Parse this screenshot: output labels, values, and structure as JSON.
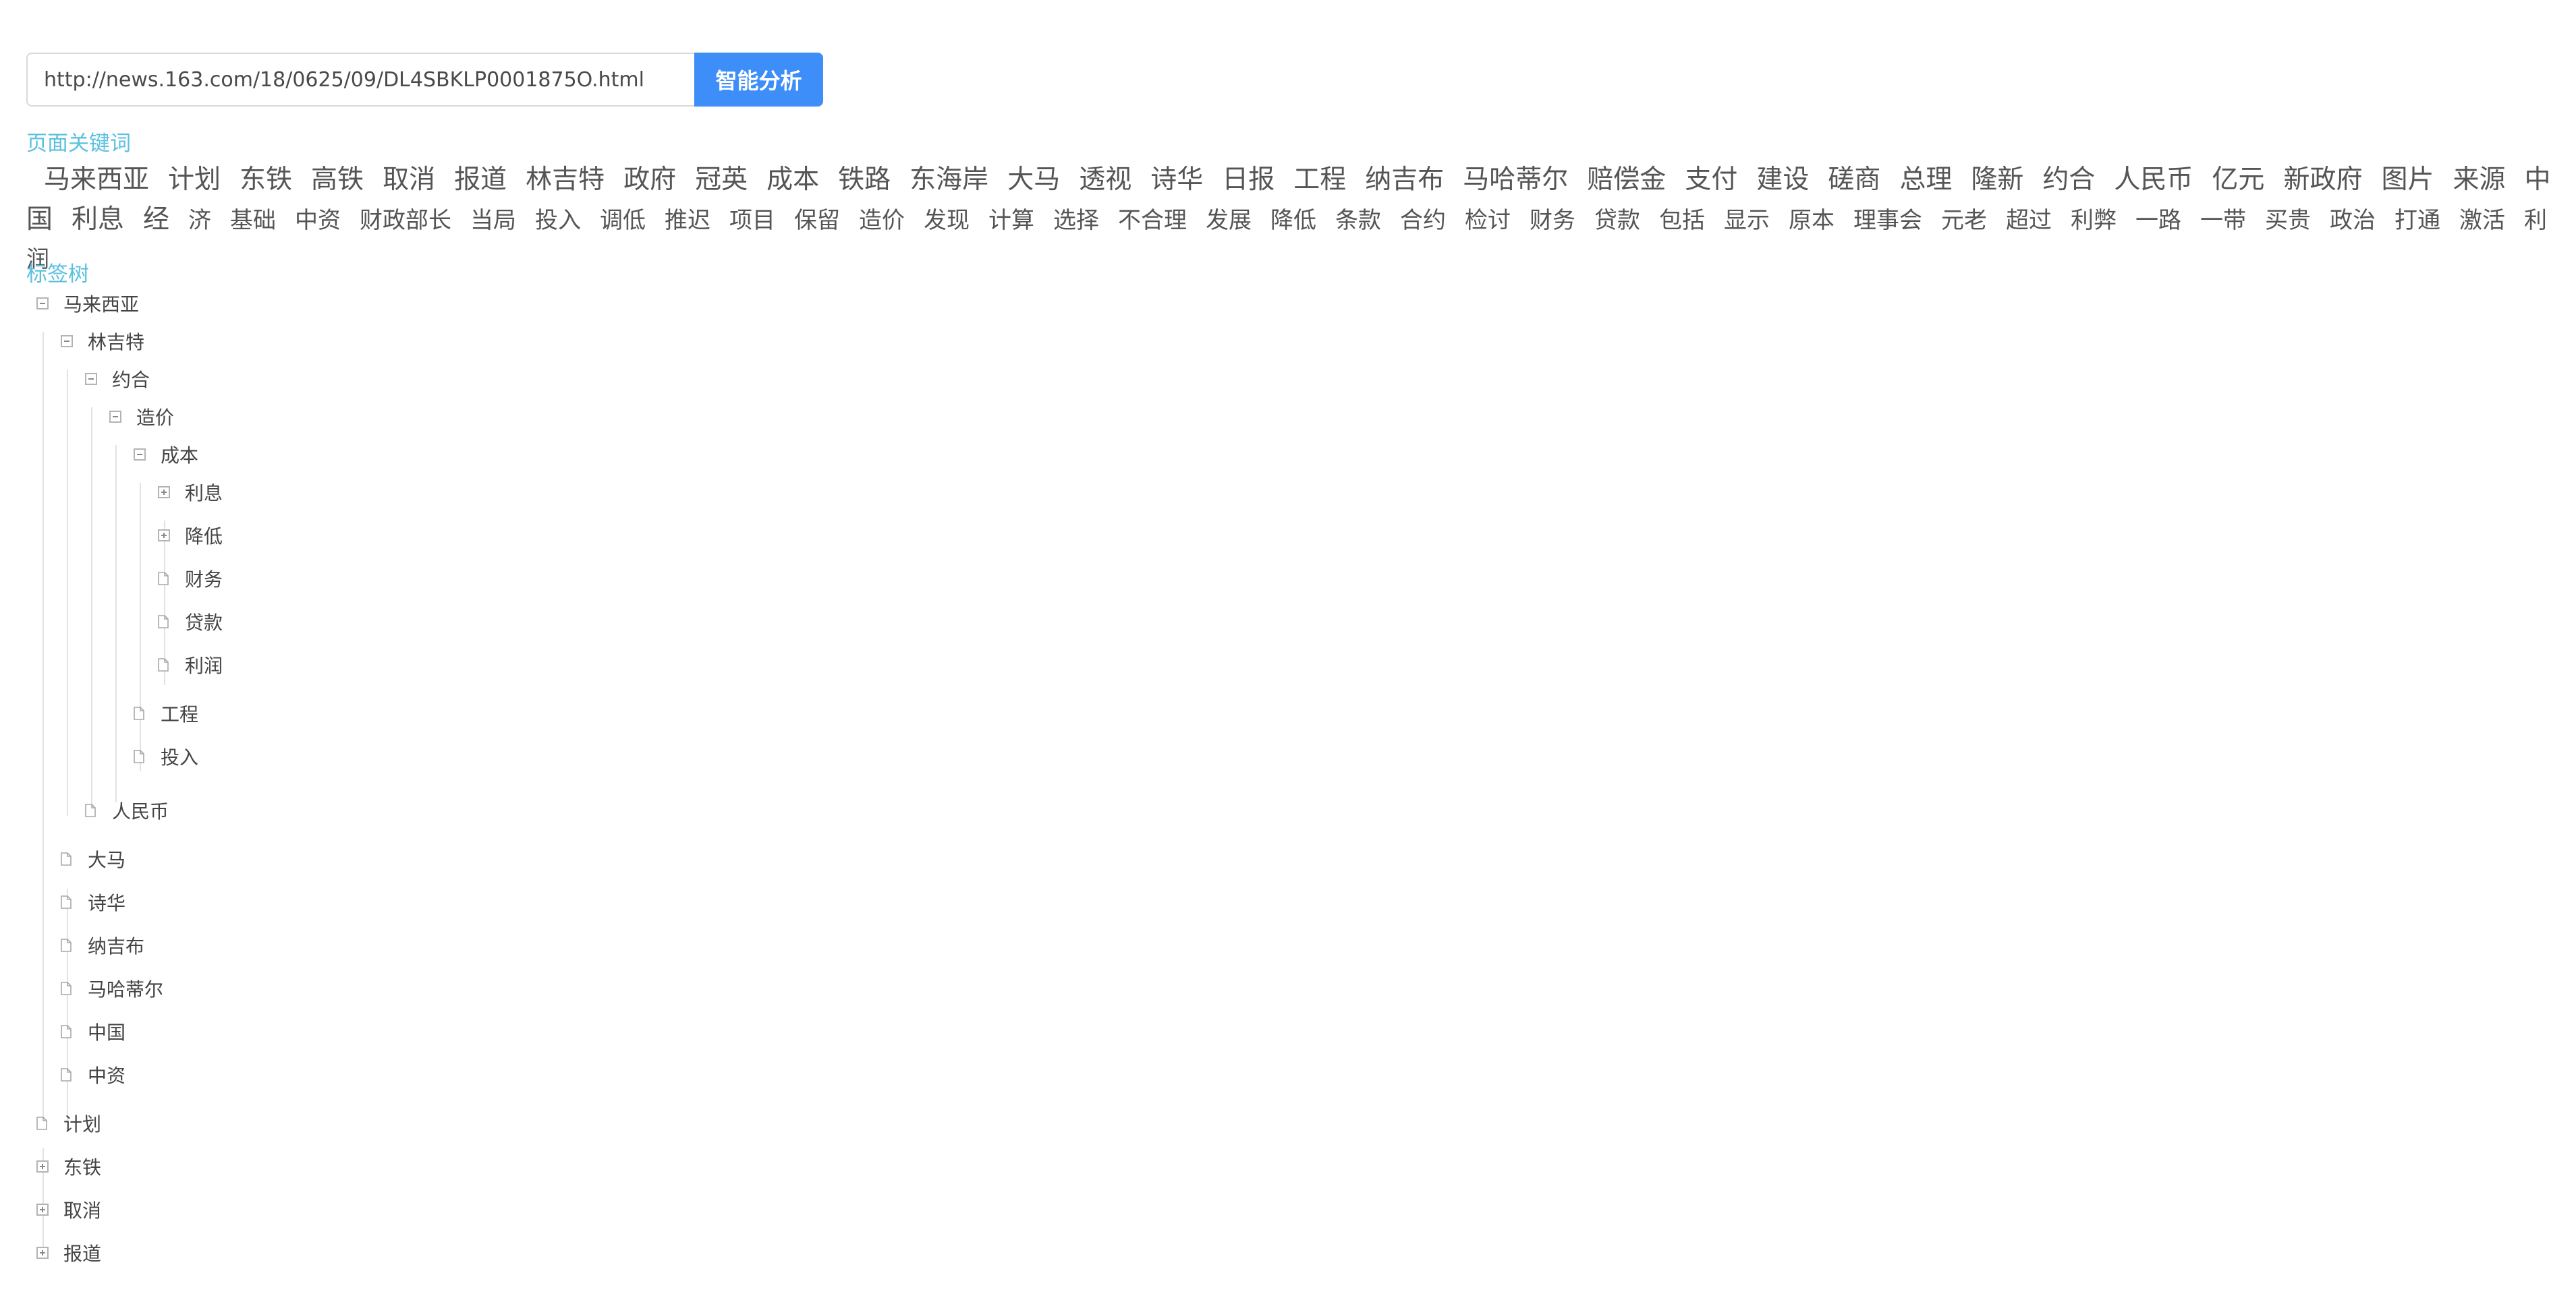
{
  "search": {
    "url_value": "http://news.163.com/18/0625/09/DL4SBKLP0001875O.html",
    "button_label": "智能分析"
  },
  "keywords_section": {
    "title": "页面关键词",
    "items": [
      "马来西亚",
      "计划",
      "东铁",
      "高铁",
      "取消",
      "报道",
      "林吉特",
      "政府",
      "冠英",
      "成本",
      "铁路",
      "东海岸",
      "大马",
      "透视",
      "诗华",
      "日报",
      "工程",
      "纳吉布",
      "马哈蒂尔",
      "赔偿金",
      "支付",
      "建设",
      "磋商",
      "总理",
      "隆新",
      "约合",
      "人民币",
      "亿元",
      "新政府",
      "图片",
      "来源",
      "中国",
      "利息",
      "经",
      "济",
      "基础",
      "中资",
      "财政部长",
      "当局",
      "投入",
      "调低",
      "推迟",
      "项目",
      "保留",
      "造价",
      "发现",
      "计算",
      "选择",
      "不合理",
      "发展",
      "降低",
      "条款",
      "合约",
      "检讨",
      "财务",
      "贷款",
      "包括",
      "显示",
      "原本",
      "理事会",
      "元老",
      "超过",
      "利弊",
      "一路",
      "一带",
      "买贵",
      "政治",
      "打通",
      "激活",
      "利润"
    ]
  },
  "tree_section": {
    "title": "标签树",
    "nodes": [
      {
        "label": "马来西亚",
        "state": "expanded"
      },
      {
        "label": "林吉特",
        "state": "expanded"
      },
      {
        "label": "约合",
        "state": "expanded"
      },
      {
        "label": "造价",
        "state": "expanded"
      },
      {
        "label": "成本",
        "state": "expanded"
      },
      {
        "label": "利息",
        "state": "collapsed"
      },
      {
        "label": "降低",
        "state": "collapsed"
      },
      {
        "label": "财务",
        "state": "leaf"
      },
      {
        "label": "贷款",
        "state": "leaf"
      },
      {
        "label": "利润",
        "state": "leaf"
      },
      {
        "label": "工程",
        "state": "leaf"
      },
      {
        "label": "投入",
        "state": "leaf"
      },
      {
        "label": "人民币",
        "state": "leaf"
      },
      {
        "label": "大马",
        "state": "leaf"
      },
      {
        "label": "诗华",
        "state": "leaf"
      },
      {
        "label": "纳吉布",
        "state": "leaf"
      },
      {
        "label": "马哈蒂尔",
        "state": "leaf"
      },
      {
        "label": "中国",
        "state": "leaf"
      },
      {
        "label": "中资",
        "state": "leaf"
      },
      {
        "label": "计划",
        "state": "leaf"
      },
      {
        "label": "东铁",
        "state": "collapsed"
      },
      {
        "label": "取消",
        "state": "collapsed"
      },
      {
        "label": "报道",
        "state": "collapsed"
      }
    ]
  },
  "colors": {
    "accent_button": "#3d8ef8",
    "section_title": "#5bc0de",
    "body_text": "#555555"
  },
  "icons": {
    "expanded": "minus-square-icon",
    "collapsed": "plus-square-icon",
    "leaf": "file-icon"
  }
}
